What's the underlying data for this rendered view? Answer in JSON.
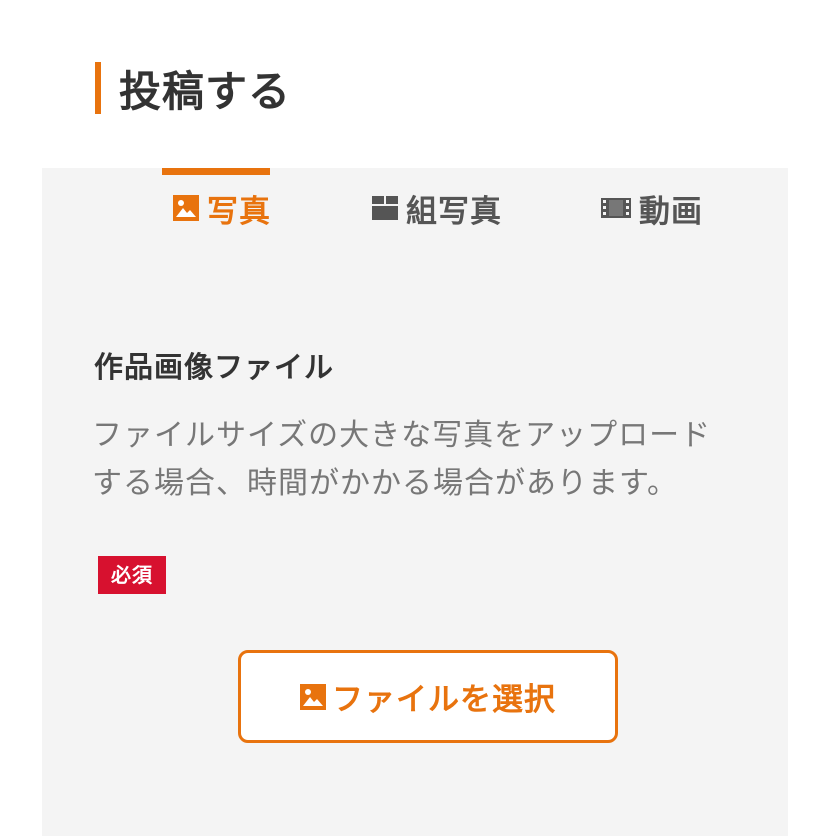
{
  "header": {
    "title": "投稿する",
    "accent_color": "#e8730e"
  },
  "tabs": [
    {
      "label": "写真",
      "icon": "image-icon",
      "active": true
    },
    {
      "label": "組写真",
      "icon": "grid-icon",
      "active": false
    },
    {
      "label": "動画",
      "icon": "film-icon",
      "active": false
    }
  ],
  "section": {
    "title": "作品画像ファイル",
    "description": "ファイルサイズの大きな写真をアップロードする場合、時間がかかる場合があります。",
    "required_label": "必須",
    "required_color": "#d7112f"
  },
  "upload_button": {
    "label": "ファイルを選択",
    "icon": "image-icon"
  }
}
